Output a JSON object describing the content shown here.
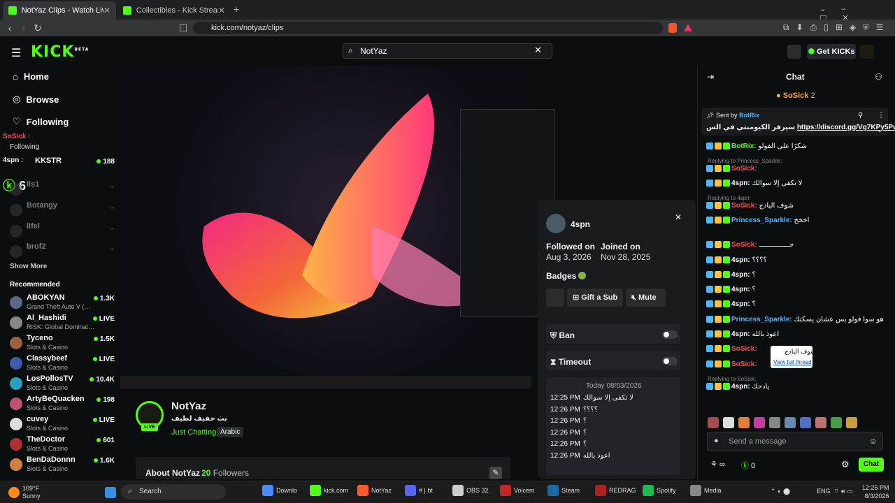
{
  "browser": {
    "tabs": [
      {
        "title": "NotYaz Clips - Watch Live on Kick",
        "active": true
      },
      {
        "title": "Collectibles - Kick Streaming",
        "active": false
      }
    ],
    "url": "kick.com/notyaz/clips",
    "new_tab": "+"
  },
  "header": {
    "logo": "KICK",
    "logo_sup": "BETA",
    "search_value": "NotYaz",
    "get_kicks": "Get KICKs"
  },
  "sidebar": {
    "nav": [
      {
        "label": "Home",
        "icon": "home-icon"
      },
      {
        "label": "Browse",
        "icon": "compass-icon"
      },
      {
        "label": "Following",
        "icon": "heart-icon"
      }
    ],
    "following": [
      {
        "name": "KKSTR",
        "viewers": "188"
      },
      {
        "name": "lls1",
        "viewers": ""
      },
      {
        "name": "Botangy",
        "viewers": ""
      },
      {
        "name": "lifel",
        "viewers": ""
      },
      {
        "name": "brof2",
        "viewers": ""
      }
    ],
    "show_more": "Show More",
    "recommended_title": "Recommended",
    "recommended": [
      {
        "name": "ABOKYAN",
        "game": "Grand Theft Auto V (…",
        "viewers": "1.3K",
        "color": "#5a6a8a"
      },
      {
        "name": "Al_Hashidi",
        "game": "RISK: Global Dominat…",
        "viewers": "LIVE",
        "color": "#888888"
      },
      {
        "name": "Tyceno",
        "game": "Slots & Casino",
        "viewers": "1.5K",
        "color": "#a06040"
      },
      {
        "name": "Classybeef",
        "game": "Slots & Casino",
        "viewers": "LIVE",
        "color": "#3b5da8"
      },
      {
        "name": "LosPollosTV",
        "game": "Slots & Casino",
        "viewers": "10.4K",
        "color": "#2aa0c0"
      },
      {
        "name": "ArtyBeQuacken",
        "game": "Slots & Casino",
        "viewers": "198",
        "color": "#c05070"
      },
      {
        "name": "cuvey",
        "game": "Slots & Casino",
        "viewers": "LIVE",
        "color": "#dddddd"
      },
      {
        "name": "TheDoctor",
        "game": "Slots & Casino",
        "viewers": "601",
        "color": "#b03030"
      },
      {
        "name": "BenDaDonnn",
        "game": "Slots & Casino",
        "viewers": "1.6K",
        "color": "#d08040"
      }
    ],
    "overlay_lines": [
      "SoSick :",
      "Following",
      "4spn :",
      "6"
    ]
  },
  "channel": {
    "name": "NotYaz",
    "live": "LIVE",
    "title": "بث خفيف لطيف",
    "category": "Just Chatting",
    "tag": "Arabic",
    "about": "About NotYaz",
    "followers_count": "20",
    "followers_label": "Followers"
  },
  "card": {
    "username": "4spn",
    "followed_label": "Followed on",
    "followed_date": "Aug 3, 2026",
    "joined_label": "Joined on",
    "joined_date": "Nov 28, 2025",
    "badges_label": "Badges",
    "gift_sub": "Gift a Sub",
    "mute": "Mute",
    "ban": "Ban",
    "timeout": "Timeout",
    "log_date": "Today 08/03/2026",
    "log": [
      {
        "time": "12:25 PM",
        "msg": "لا تكفى إلا سوالك"
      },
      {
        "time": "12:26 PM",
        "msg": "؟؟؟؟"
      },
      {
        "time": "12:26 PM",
        "msg": "؟"
      },
      {
        "time": "12:26 PM",
        "msg": "؟"
      },
      {
        "time": "12:26 PM",
        "msg": "؟"
      },
      {
        "time": "12:26 PM",
        "msg": "اعوذ بالله"
      }
    ]
  },
  "chat": {
    "title": "Chat",
    "top_gifter": "SoSick",
    "top_gifter_count": "2",
    "pinned_sender_label": "Sent by",
    "pinned_sender": "BotRix",
    "pinned_text": "سيرفر الكيومنتي في الس",
    "pinned_link": "https://discord.gg/Vg7KPy5Pw",
    "messages": [
      {
        "user": "BotRix",
        "cls": "u-green",
        "text": "شكرًا على الفولو",
        "reply": ""
      },
      {
        "user": "SoSick",
        "cls": "u-red",
        "text": "",
        "reply": "Replying to Princess_Sparkle:"
      },
      {
        "user": "4spn",
        "cls": "u-white",
        "text": "لا تكفى إلا سوالك",
        "reply": ""
      },
      {
        "user": "SoSick",
        "cls": "u-red",
        "text": "شوف البادج",
        "reply": "Replying to 4spn:"
      },
      {
        "user": "Princess_Sparkle",
        "cls": "u-blue",
        "text": "اخخخ",
        "reply": ""
      },
      {
        "user": "SoSick",
        "cls": "u-red",
        "text": "حـــــــــــــــ",
        "reply": ""
      },
      {
        "user": "4spn",
        "cls": "u-white",
        "text": "؟؟؟؟",
        "reply": ""
      },
      {
        "user": "4spn",
        "cls": "u-white",
        "text": "؟",
        "reply": ""
      },
      {
        "user": "4spn",
        "cls": "u-white",
        "text": "؟",
        "reply": ""
      },
      {
        "user": "4spn",
        "cls": "u-white",
        "text": "؟",
        "reply": ""
      },
      {
        "user": "Princess_Sparkle",
        "cls": "u-blue",
        "text": "هو سوا فولو بس عشان يسكتك",
        "reply": ""
      },
      {
        "user": "4spn",
        "cls": "u-white",
        "text": "اعوذ بالله",
        "reply": ""
      },
      {
        "user": "SoSick",
        "cls": "u-red",
        "text": "",
        "reply": ""
      },
      {
        "user": "SoSick",
        "cls": "u-red",
        "text": "",
        "reply": ""
      },
      {
        "user": "4spn",
        "cls": "u-white",
        "text": "يادحك",
        "reply": "Replying to SoSick:"
      }
    ],
    "tooltip_text": "شوف البادج",
    "tooltip_link": "View full thread",
    "input_placeholder": "Send a message",
    "kicks_count": "0",
    "send_button": "Chat"
  },
  "taskbar": {
    "weather_temp": "109°F",
    "weather_desc": "Sunny",
    "search": "Search",
    "apps": [
      {
        "label": "Downlo",
        "color": "#4a8cff"
      },
      {
        "label": "kick.com",
        "color": "#53fc18"
      },
      {
        "label": "NotYaz",
        "color": "#ff5a2b"
      },
      {
        "label": "# | bt",
        "color": "#5865f2"
      },
      {
        "label": "OBS 32.",
        "color": "#cccccc"
      },
      {
        "label": "Voicem",
        "color": "#c02828"
      },
      {
        "label": "Steam",
        "color": "#1b6aa5"
      },
      {
        "label": "REDRAG",
        "color": "#aa2222"
      },
      {
        "label": "Spotify",
        "color": "#1db954"
      },
      {
        "label": "Media",
        "color": "#888888"
      }
    ],
    "lang": "ENG",
    "time": "12:26 PM",
    "date": "8/3/2026"
  }
}
